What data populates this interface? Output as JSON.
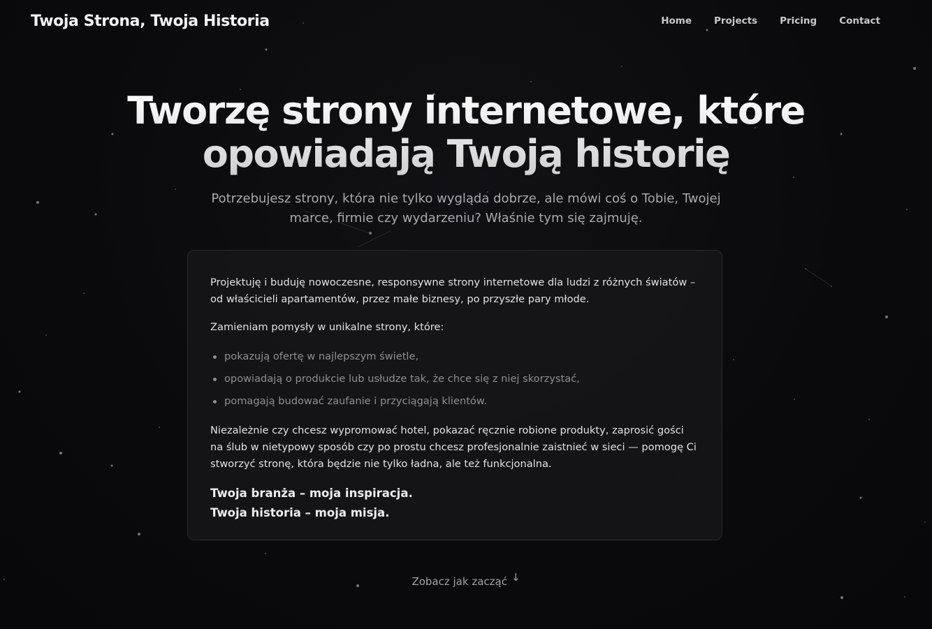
{
  "header": {
    "brand": "Twoja Strona, Twoja Historia",
    "nav": [
      "Home",
      "Projects",
      "Pricing",
      "Contact"
    ]
  },
  "hero": {
    "title_line1": "Tworzę strony internetowe, które",
    "title_line2": "opowiadają Twoją historię",
    "subtitle": "Potrzebujesz strony, która nie tylko wygląda dobrze, ale mówi coś o Tobie, Twojej marce, firmie czy wydarzeniu? Właśnie tym się zajmuję."
  },
  "card": {
    "intro": "Projektuję i buduję nowoczesne, responsywne strony internetowe dla ludzi z różnych światów – od właścicieli apartamentów, przez małe biznesy, po przyszłe pary młode.",
    "lead": "Zamieniam pomysły w unikalne strony, które:",
    "bullets": [
      "pokazują ofertę w najlepszym świetle,",
      "opowiadają o produkcie lub usłudze tak, że chce się z niej skorzystać,",
      "pomagają budować zaufanie i przyciągają klientów."
    ],
    "body": "Niezależnie czy chcesz wypromować hotel, pokazać ręcznie robione produkty, zaprosić gości na ślub w nietypowy sposób czy po prostu chcesz profesjonalnie zaistnieć w sieci — pomogę Ci stworzyć stronę, która będzie nie tylko ładna, ale też funkcjonalna.",
    "tagline1": "Twoja branża – moja inspiracja.",
    "tagline2": "Twoja historia – moja misja."
  },
  "cta": {
    "label": "Zobacz jak zacząć",
    "icon": "arrow-down-icon"
  },
  "colors": {
    "background": "#0b0b0d",
    "card": "#161618",
    "text": "#e8e8e8",
    "muted": "#8e8e94"
  }
}
